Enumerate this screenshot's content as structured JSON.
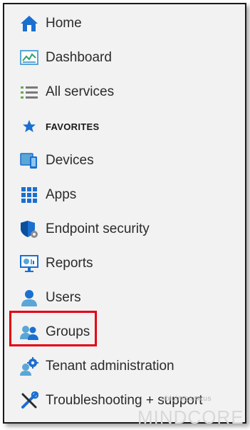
{
  "nav": {
    "items": [
      {
        "label": "Home",
        "icon": "home-icon"
      },
      {
        "label": "Dashboard",
        "icon": "dashboard-icon"
      },
      {
        "label": "All services",
        "icon": "list-icon"
      },
      {
        "label": "Devices",
        "icon": "devices-icon"
      },
      {
        "label": "Apps",
        "icon": "apps-grid-icon"
      },
      {
        "label": "Endpoint security",
        "icon": "shield-gear-icon"
      },
      {
        "label": "Reports",
        "icon": "reports-monitor-icon"
      },
      {
        "label": "Users",
        "icon": "user-icon"
      },
      {
        "label": "Groups",
        "icon": "groups-icon"
      },
      {
        "label": "Tenant administration",
        "icon": "tenant-admin-icon"
      },
      {
        "label": "Troubleshooting + support",
        "icon": "tools-icon"
      }
    ],
    "favorites_label": "FAVORITES",
    "highlighted_item": "Groups"
  },
  "colors": {
    "accent": "#0078d4",
    "highlight_box": "#e3000f",
    "background": "#f2f2f2",
    "text": "#2b2b2b"
  },
  "watermark": {
    "brand": "MINDCORE",
    "tagline": "ubluimtuuoxus"
  }
}
